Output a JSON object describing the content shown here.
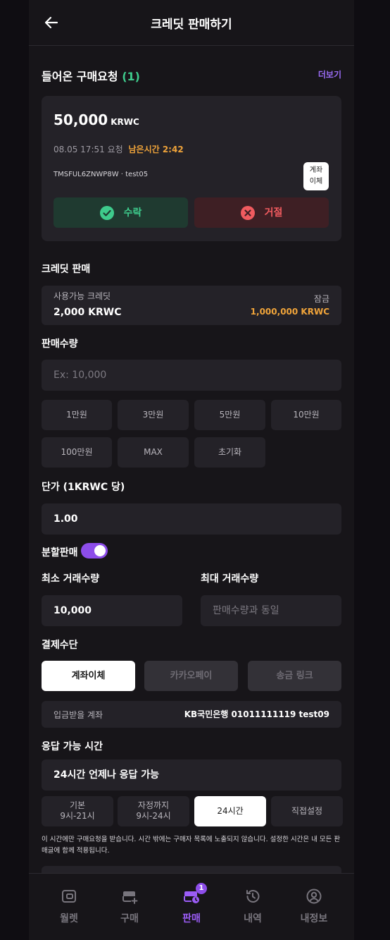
{
  "header": {
    "title": "크레딧 판매하기"
  },
  "requests": {
    "title": "들어온 구매요청",
    "count": "(1)",
    "more_label": "더보기",
    "card": {
      "amount": "50,000",
      "unit": "KRWC",
      "request_time": "08.05 17:51 요청",
      "remaining": "남은시간 2:42",
      "code": "TMSFUL6ZNWP8W · test05",
      "method_badge_line1": "계좌",
      "method_badge_line2": "이체",
      "accept_label": "수락",
      "reject_label": "거절"
    }
  },
  "credit_sale": {
    "title": "크레딧 판매",
    "available_label": "사용가능 크레딧",
    "available_value": "2,000 KRWC",
    "locked_label": "잠금",
    "locked_value": "1,000,000 KRWC"
  },
  "quantity": {
    "title": "판매수량",
    "placeholder": "Ex: 10,000",
    "chips": [
      "1만원",
      "3만원",
      "5만원",
      "10만원",
      "100만원",
      "MAX",
      "초기화"
    ]
  },
  "price": {
    "title": "단가 (1KRWC 당)",
    "value": "1.00"
  },
  "split": {
    "label": "분할판매",
    "enabled": true
  },
  "min_qty": {
    "title": "최소 거래수량",
    "value": "10,000"
  },
  "max_qty": {
    "title": "최대 거래수량",
    "placeholder": "판매수량과 동일"
  },
  "payment": {
    "title": "결제수단",
    "options": [
      "계좌이체",
      "카카오페이",
      "송금 링크"
    ],
    "selected": "계좌이체",
    "account_label": "입금받을 계좌",
    "account_value": "KB국민은행 01011111119 test09"
  },
  "response_time": {
    "title": "응답 가능 시간",
    "current": "24시간 언제나 응답 가능",
    "options": [
      {
        "line1": "기본",
        "line2": "9시-21시"
      },
      {
        "line1": "자정까지",
        "line2": "9시-24시"
      },
      {
        "line1": "24시간",
        "line2": ""
      },
      {
        "line1": "직접설정",
        "line2": ""
      }
    ],
    "selected": "24시간",
    "notice": "이 시간에만 구매요청을 받습니다. 시간 밖에는 구매자 목록에 노출되지 않습니다. 설정한 시간은 내 모든 판매글에 함께 적용됩니다."
  },
  "nav": {
    "items": [
      {
        "label": "월렛",
        "icon": "wallet-icon"
      },
      {
        "label": "구매",
        "icon": "card-plus-icon"
      },
      {
        "label": "판매",
        "icon": "card-clock-icon",
        "badge": "1"
      },
      {
        "label": "내역",
        "icon": "history-icon"
      },
      {
        "label": "내정보",
        "icon": "user-icon"
      }
    ],
    "active": "판매"
  },
  "colors": {
    "accent": "#8d4dea",
    "success": "#3ecb8c",
    "danger": "#f05b5f",
    "warning": "#f0a43a"
  }
}
